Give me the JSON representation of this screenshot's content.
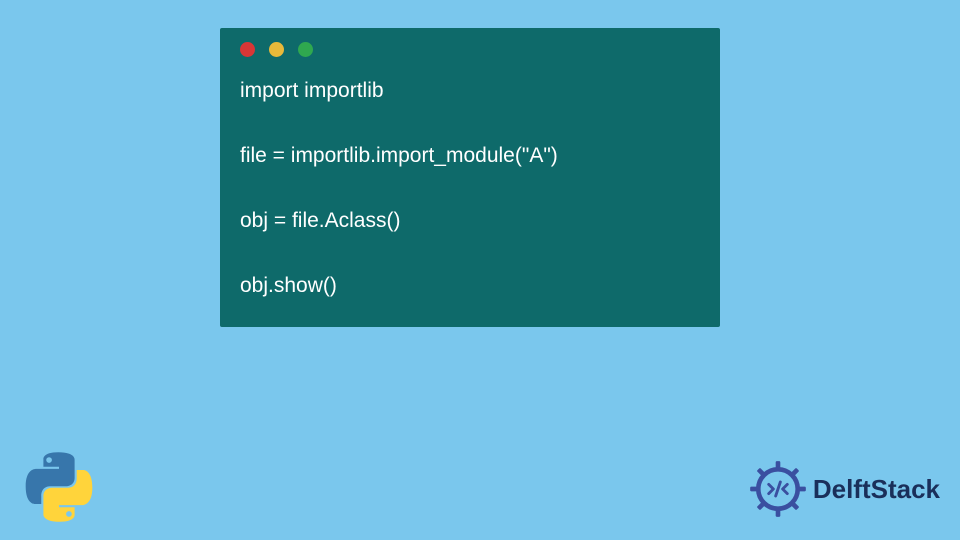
{
  "code": {
    "lines": "import importlib\n\nfile = importlib.import_module(\"A\")\n\nobj = file.Aclass()\n\nobj.show()"
  },
  "branding": {
    "site_name": "DelftStack"
  },
  "colors": {
    "page_bg": "#7ac7ed",
    "window_bg": "#0e6a6a",
    "dot_red": "#d93636",
    "dot_yellow": "#e8b93a",
    "dot_green": "#2fa84f",
    "brand_text": "#1a2f5a",
    "brand_accent": "#3a4fa0"
  }
}
